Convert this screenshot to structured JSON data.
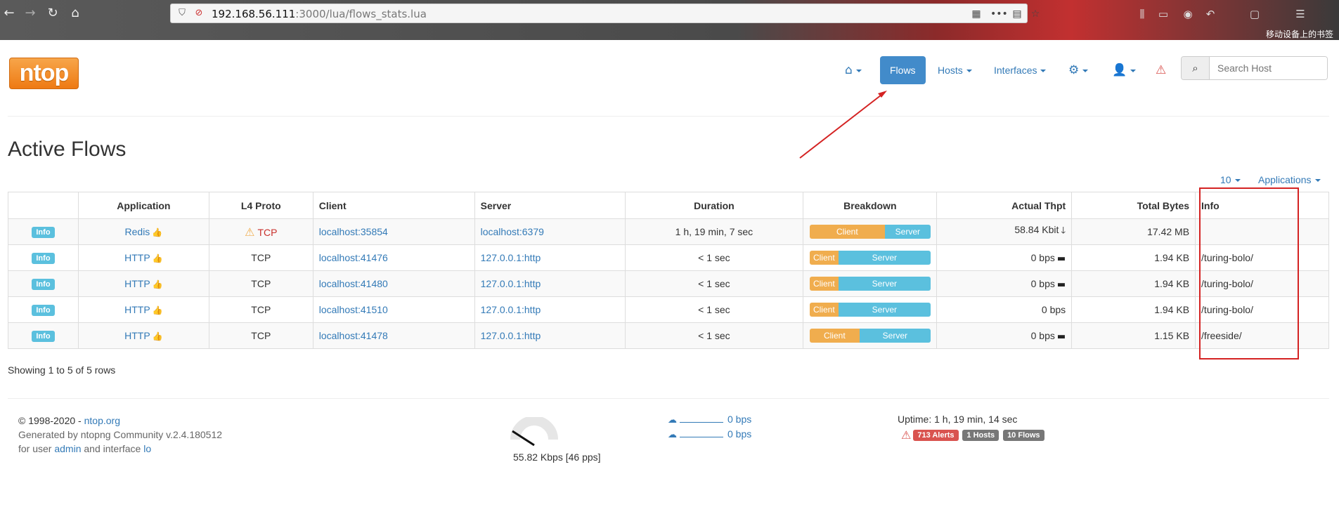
{
  "browser": {
    "url_host": "192.168.56.111",
    "url_rest": ":3000/lua/flows_stats.lua",
    "bookmarks_label": "移动设备上的书签"
  },
  "nav": {
    "flows_label": "Flows",
    "hosts_label": "Hosts",
    "interfaces_label": "Interfaces",
    "search_placeholder": "Search Host"
  },
  "logo_text": "ntop",
  "page_title": "Active Flows",
  "table_controls": {
    "page_size": "10",
    "filter": "Applications"
  },
  "table": {
    "headers": [
      "",
      "Application",
      "L4 Proto",
      "Client",
      "Server",
      "Duration",
      "Breakdown",
      "Actual Thpt",
      "Total Bytes",
      "Info"
    ],
    "rows": [
      {
        "info_btn": "Info",
        "application": "Redis",
        "proto": "TCP",
        "proto_warning": true,
        "client": "localhost:35854",
        "server": "localhost:6379",
        "duration": "1 h, 19 min, 7 sec",
        "client_label": "Client",
        "server_label": "Server",
        "client_share": 0.62,
        "thpt": "58.84 Kbit",
        "trend": "down",
        "bytes": "17.42 MB",
        "info": ""
      },
      {
        "info_btn": "Info",
        "application": "HTTP",
        "proto": "TCP",
        "proto_warning": false,
        "client": "localhost:41476",
        "server": "127.0.0.1:http",
        "duration": "< 1 sec",
        "client_label": "Client",
        "server_label": "Server",
        "client_share": 0.24,
        "thpt": "0 bps",
        "trend": "flat",
        "bytes": "1.94 KB",
        "info": "/turing-bolo/"
      },
      {
        "info_btn": "Info",
        "application": "HTTP",
        "proto": "TCP",
        "proto_warning": false,
        "client": "localhost:41480",
        "server": "127.0.0.1:http",
        "duration": "< 1 sec",
        "client_label": "Client",
        "server_label": "Server",
        "client_share": 0.24,
        "thpt": "0 bps",
        "trend": "flat",
        "bytes": "1.94 KB",
        "info": "/turing-bolo/"
      },
      {
        "info_btn": "Info",
        "application": "HTTP",
        "proto": "TCP",
        "proto_warning": false,
        "client": "localhost:41510",
        "server": "127.0.0.1:http",
        "duration": "< 1 sec",
        "client_label": "Client",
        "server_label": "Server",
        "client_share": 0.24,
        "thpt": "0 bps",
        "trend": "none",
        "bytes": "1.94 KB",
        "info": "/turing-bolo/"
      },
      {
        "info_btn": "Info",
        "application": "HTTP",
        "proto": "TCP",
        "proto_warning": false,
        "client": "localhost:41478",
        "server": "127.0.0.1:http",
        "duration": "< 1 sec",
        "client_label": "Client",
        "server_label": "Server",
        "client_share": 0.41,
        "thpt": "0 bps",
        "trend": "flat",
        "bytes": "1.15 KB",
        "info": "/freeside/"
      }
    ]
  },
  "showing_text": "Showing 1 to 5 of 5 rows",
  "footer": {
    "copyright_prefix": "© 1998-2020 - ",
    "copyright_link": "ntop.org",
    "generated": "Generated by ntopng Community v.2.4.180512",
    "for_user_prefix": "for user ",
    "user": "admin",
    "and_interface": " and interface ",
    "interface": "lo",
    "gauge_text": "55.82 Kbps [46 pps]",
    "upload": "0 bps",
    "download": "0 bps",
    "uptime": "Uptime: 1 h, 19 min, 14 sec",
    "alerts_badge": "713 Alerts",
    "hosts_badge": "1 Hosts",
    "flows_badge": "10 Flows"
  },
  "colors": {
    "link": "#337ab7",
    "active_nav": "#428bca",
    "client_bar": "#f0ad4e",
    "server_bar": "#5bc0de",
    "alert": "#d9534f",
    "annotation": "#d42222"
  },
  "icons": [
    "back-icon",
    "forward-icon",
    "reload-icon",
    "home-icon",
    "shield-icon",
    "insecure-lock-icon",
    "qr-icon",
    "more-icon",
    "star-icon",
    "library-icon",
    "house-icon",
    "gear-icon",
    "user-icon",
    "alert-icon",
    "search-icon",
    "thumbs-up-icon",
    "warning-icon",
    "arrow-down-icon",
    "minus-icon",
    "cloud-upload-icon",
    "cloud-download-icon"
  ]
}
